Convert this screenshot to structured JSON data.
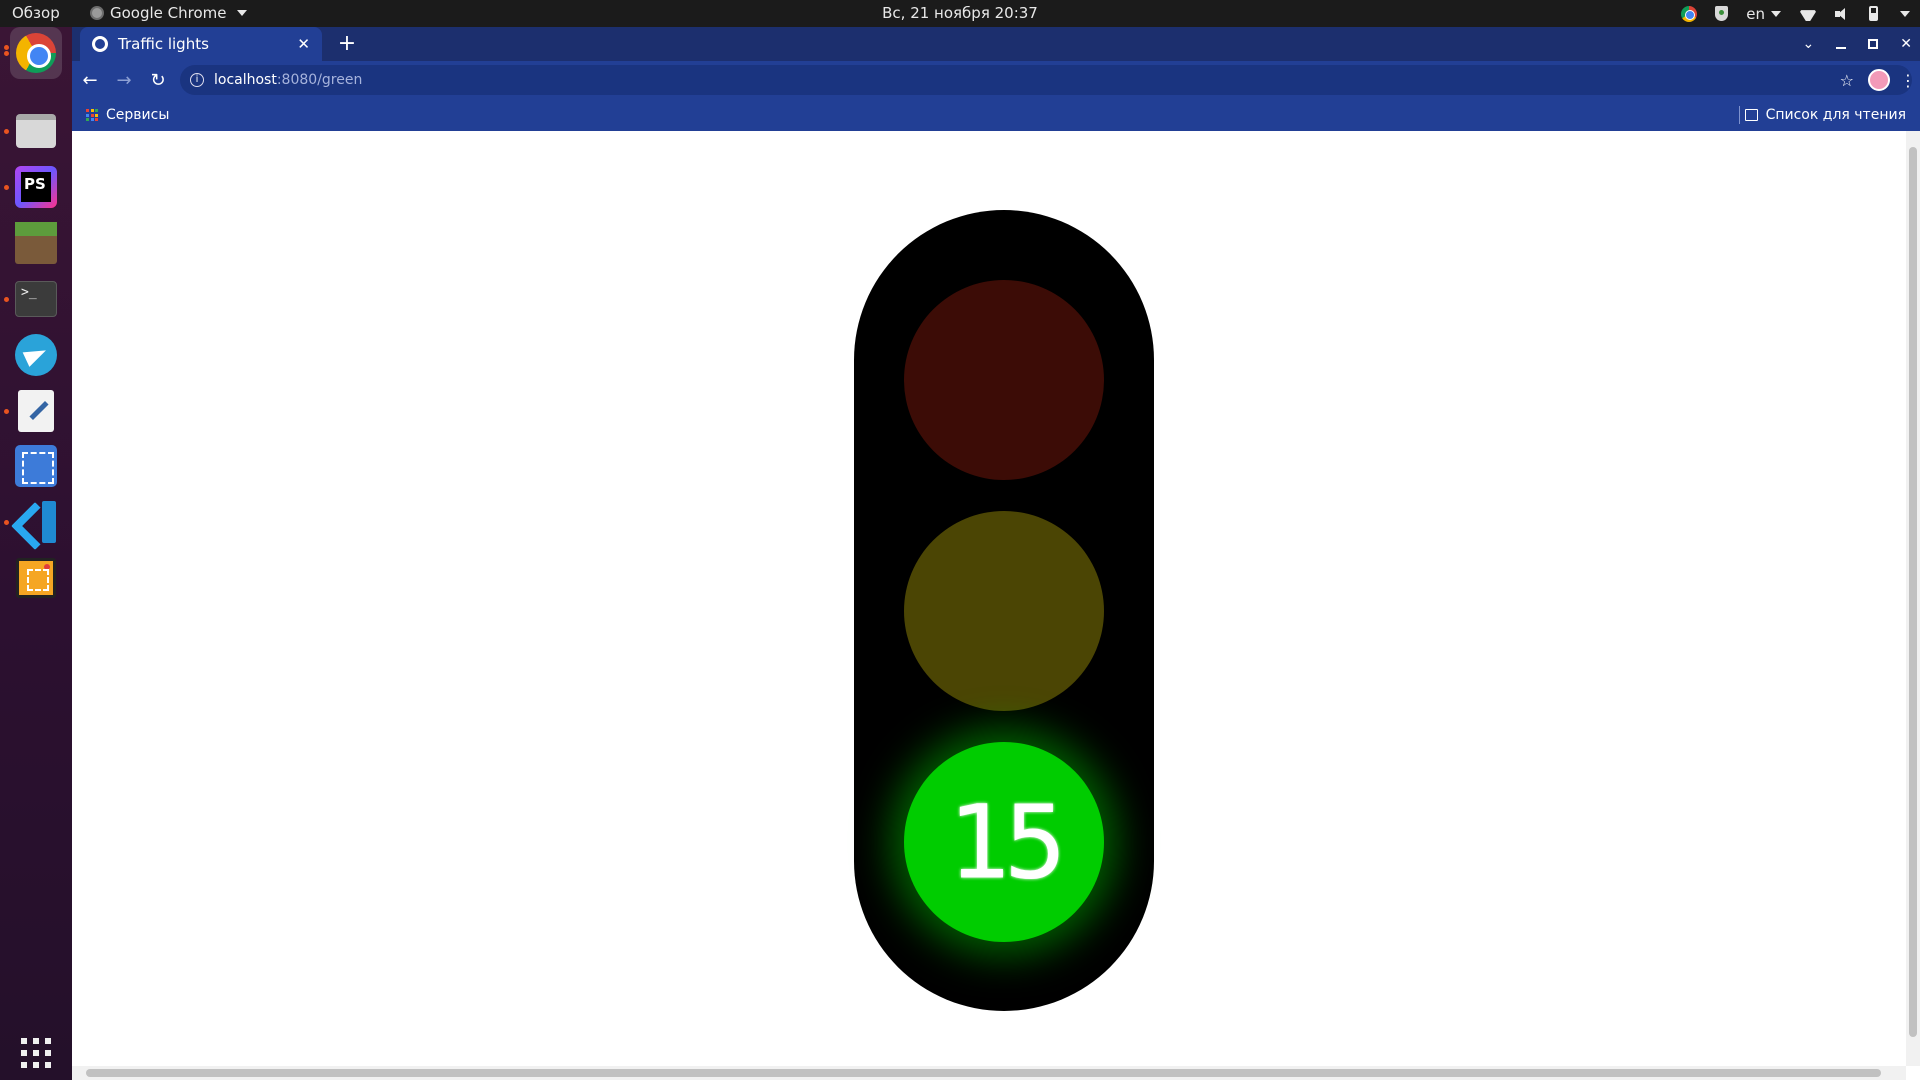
{
  "topbar": {
    "activities_label": "Обзор",
    "app_name": "Google Chrome",
    "clock": "Вс, 21 ноября  20:37",
    "keyboard_layout": "en"
  },
  "dock": {
    "items": [
      {
        "name": "Google Chrome",
        "icon": "chrome-icon",
        "running": true,
        "active": true
      },
      {
        "name": "Files",
        "icon": "files-icon",
        "running": true
      },
      {
        "name": "PhpStorm",
        "icon": "phpstorm-icon",
        "running": true,
        "label": "PS"
      },
      {
        "name": "Minecraft",
        "icon": "minecraft-icon"
      },
      {
        "name": "Terminal",
        "icon": "terminal-icon",
        "running": true,
        "label": ">_"
      },
      {
        "name": "Telegram",
        "icon": "telegram-icon"
      },
      {
        "name": "Text Editor",
        "icon": "text-editor-icon",
        "running": true
      },
      {
        "name": "Screenshot",
        "icon": "screenshot-icon"
      },
      {
        "name": "Visual Studio Code",
        "icon": "vscode-icon",
        "running": true
      },
      {
        "name": "Screen Recorder",
        "icon": "screen-recorder-icon"
      },
      {
        "name": "Show Applications",
        "icon": "app-grid-icon"
      }
    ]
  },
  "browser": {
    "tab_title": "Traffic lights",
    "url_host": "localhost",
    "url_path": ":8080/green",
    "bookmarks": {
      "apps_label": "Сервисы",
      "reading_list_label": "Список для чтения"
    },
    "theme_colors": {
      "tabstrip": "#1c2f6e",
      "toolbar": "#223f95",
      "omnibox": "#1a3480"
    }
  },
  "page": {
    "traffic_light": {
      "active_light": "green",
      "countdown": "15",
      "colors": {
        "red_off": "#3c0c06",
        "yellow_off": "#4b4504",
        "green_on": "#00cc00",
        "housing": "#000000"
      }
    }
  }
}
